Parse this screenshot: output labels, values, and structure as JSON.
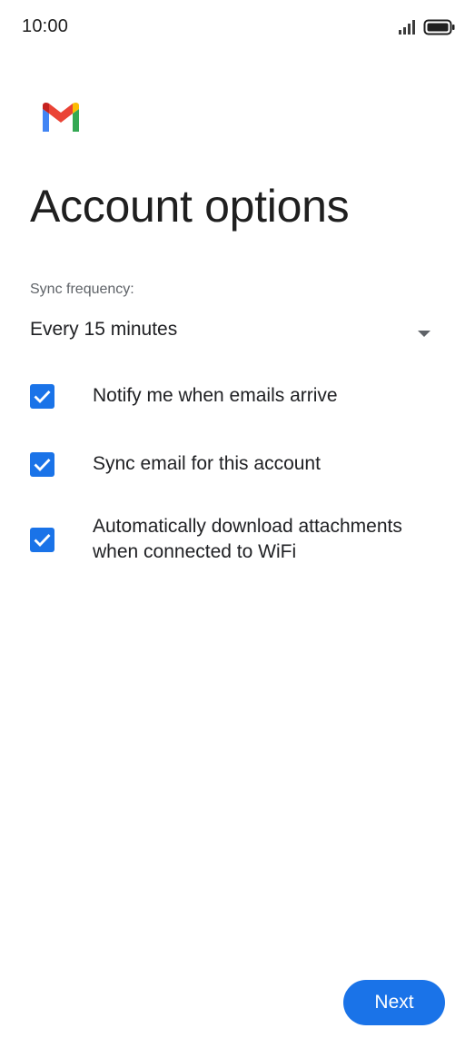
{
  "status_bar": {
    "time": "10:00",
    "signal_icon": "signal-bars-icon",
    "battery_icon": "battery-full-icon"
  },
  "logo": {
    "icon": "gmail-logo-icon"
  },
  "title": "Account options",
  "sync": {
    "label": "Sync frequency:",
    "selected": "Every 15 minutes",
    "dropdown_icon": "dropdown-arrow-icon"
  },
  "options": [
    {
      "label": "Notify me when emails arrive",
      "checked": true
    },
    {
      "label": "Sync email for this account",
      "checked": true
    },
    {
      "label": "Automatically download attachments when connected to WiFi",
      "checked": true
    }
  ],
  "next_button": {
    "label": "Next"
  },
  "colors": {
    "accent": "#1a73e8",
    "text": "#202124",
    "secondary_text": "#5f6368",
    "gmail_red": "#ea4335",
    "gmail_blue": "#4285f4",
    "gmail_green": "#34a853",
    "gmail_yellow": "#fbbc04",
    "gmail_dark_red": "#c5221f"
  }
}
